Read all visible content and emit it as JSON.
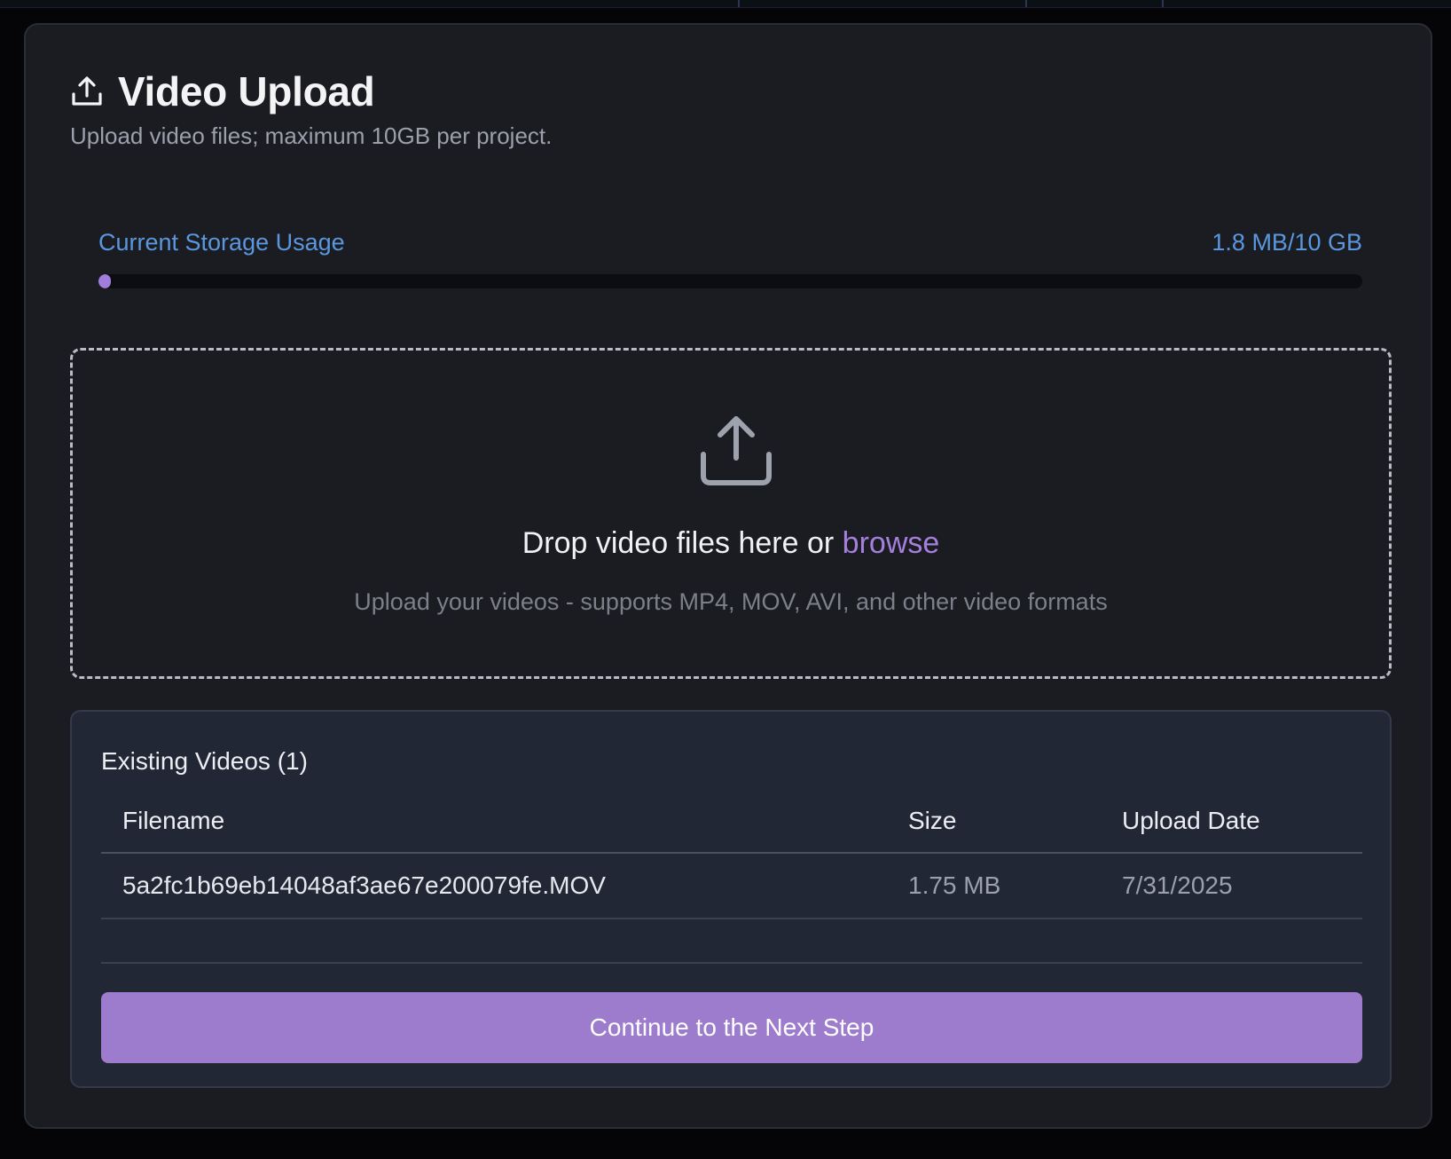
{
  "page": {
    "title": "Video Upload",
    "subtitle": "Upload video files; maximum 10GB per project."
  },
  "storage": {
    "label": "Current Storage Usage",
    "value_text": "1.8 MB/10 GB",
    "used_fraction": 0.00018,
    "bar_color": "#a17ddb"
  },
  "dropzone": {
    "icon": "upload-icon",
    "prompt": "Drop video files here or",
    "browse_label": "browse",
    "hint": "Upload your videos - supports MP4, MOV, AVI, and other video formats"
  },
  "existing": {
    "title": "Existing Videos (1)",
    "columns": [
      "Filename",
      "Size",
      "Upload Date"
    ],
    "rows": [
      {
        "filename": "5a2fc1b69eb14048af3ae67e200079fe.MOV",
        "size": "1.75 MB",
        "upload_date": "7/31/2025"
      }
    ]
  },
  "actions": {
    "continue_label": "Continue to the Next Step"
  },
  "colors": {
    "accent": "#a47fdc",
    "button": "#9d7ccd",
    "link_blue": "#5a97de",
    "panel_bg": "#1b1c21",
    "card_bg": "#222735"
  }
}
